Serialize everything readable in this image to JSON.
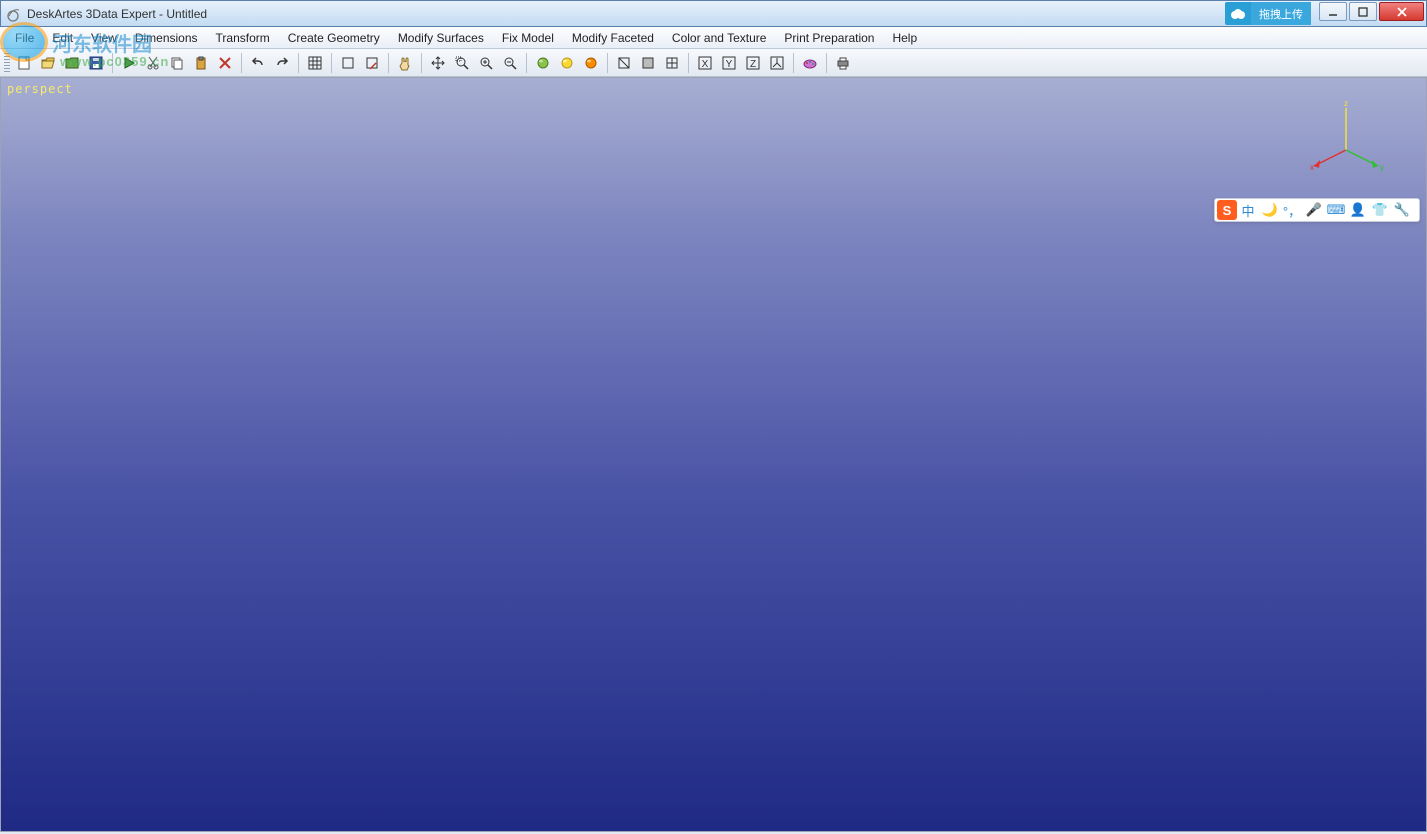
{
  "title": "DeskArtes 3Data Expert - Untitled",
  "cloud_upload_label": "拖拽上传",
  "watermark": {
    "text": "河东软件园",
    "url": "www.pc0359.cn"
  },
  "menus": [
    {
      "label": "File"
    },
    {
      "label": "Edit"
    },
    {
      "label": "View"
    },
    {
      "label": "Dimensions"
    },
    {
      "label": "Transform"
    },
    {
      "label": "Create Geometry"
    },
    {
      "label": "Modify Surfaces"
    },
    {
      "label": "Fix Model"
    },
    {
      "label": "Modify Faceted"
    },
    {
      "label": "Color and Texture"
    },
    {
      "label": "Print Preparation"
    },
    {
      "label": "Help"
    }
  ],
  "toolbar": [
    {
      "name": "new-file-icon"
    },
    {
      "name": "open-file-icon"
    },
    {
      "name": "open-folder-icon"
    },
    {
      "name": "save-icon"
    },
    {
      "name": "sep"
    },
    {
      "name": "run-icon"
    },
    {
      "name": "cut-icon"
    },
    {
      "name": "copy-icon"
    },
    {
      "name": "paste-icon"
    },
    {
      "name": "delete-icon"
    },
    {
      "name": "sep"
    },
    {
      "name": "undo-icon"
    },
    {
      "name": "redo-icon"
    },
    {
      "name": "sep"
    },
    {
      "name": "grid-toggle-icon"
    },
    {
      "name": "sep"
    },
    {
      "name": "select-box-icon"
    },
    {
      "name": "select-edit-icon"
    },
    {
      "name": "sep"
    },
    {
      "name": "hand-icon"
    },
    {
      "name": "sep"
    },
    {
      "name": "move-icon"
    },
    {
      "name": "zoom-window-icon"
    },
    {
      "name": "zoom-in-icon"
    },
    {
      "name": "zoom-out-icon"
    },
    {
      "name": "sep"
    },
    {
      "name": "shade-green-icon"
    },
    {
      "name": "shade-yellow-icon"
    },
    {
      "name": "shade-orange-icon"
    },
    {
      "name": "sep"
    },
    {
      "name": "view-wireframe-icon"
    },
    {
      "name": "view-shaded-icon"
    },
    {
      "name": "view-grid-icon"
    },
    {
      "name": "sep"
    },
    {
      "name": "axis-x-icon"
    },
    {
      "name": "axis-y-icon"
    },
    {
      "name": "axis-z-icon"
    },
    {
      "name": "axis-iso-icon"
    },
    {
      "name": "sep"
    },
    {
      "name": "paint-icon"
    },
    {
      "name": "sep"
    },
    {
      "name": "print-icon"
    }
  ],
  "viewport": {
    "label": "perspect",
    "axes": {
      "x": "x",
      "y": "y",
      "z": "z"
    }
  },
  "ime": {
    "logo": "S",
    "items": [
      {
        "name": "ime-lang-icon",
        "glyph": "中"
      },
      {
        "name": "ime-moon-icon",
        "glyph": "🌙"
      },
      {
        "name": "ime-punct-icon",
        "glyph": "°，"
      },
      {
        "name": "ime-mic-icon",
        "glyph": "🎤"
      },
      {
        "name": "ime-keyboard-icon",
        "glyph": "⌨"
      },
      {
        "name": "ime-person-icon",
        "glyph": "👤"
      },
      {
        "name": "ime-shirt-icon",
        "glyph": "👕"
      },
      {
        "name": "ime-wrench-icon",
        "glyph": "🔧"
      }
    ]
  }
}
